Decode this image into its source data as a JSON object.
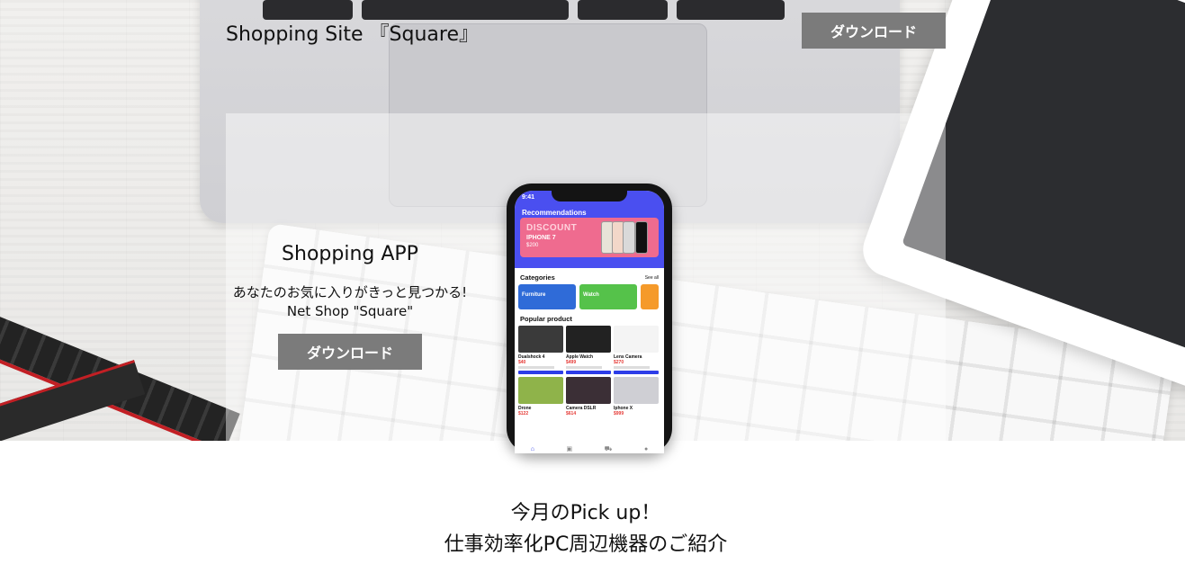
{
  "header": {
    "site_title": "Shopping Site 『Square』",
    "download_label": "ダウンロード"
  },
  "hero": {
    "title": "Shopping APP",
    "subtitle_line1": "あなたのお気に入りがきっと見つかる!",
    "subtitle_line2": "Net Shop \"Square\"",
    "download_label": "ダウンロード"
  },
  "phone_screen": {
    "time": "9:41",
    "recommendations": "Recommendations",
    "banner": {
      "discount": "DISCOUNT",
      "product": "IPHONE 7",
      "price": "$200"
    },
    "categories_title": "Categories",
    "see_all": "See all",
    "categories": [
      {
        "label": "Furniture",
        "color": "#2f6bd8"
      },
      {
        "label": "Watch",
        "color": "#55c24a"
      },
      {
        "label": "",
        "color": "#f59a2a"
      }
    ],
    "popular_title": "Popular product",
    "products": [
      {
        "name": "Dualshock 4",
        "price": "$40"
      },
      {
        "name": "Apple Watch",
        "price": "$499"
      },
      {
        "name": "Lens Camera",
        "price": "$270"
      },
      {
        "name": "Drone",
        "price": "$122"
      },
      {
        "name": "Camera DSLR",
        "price": "$614"
      },
      {
        "name": "Iphone X",
        "price": "$999"
      }
    ]
  },
  "pickup": {
    "line1": "今月のPick up！",
    "line2": "仕事効率化PC周辺機器のご紹介"
  },
  "colors": {
    "button_bg": "#7b7b7b",
    "button_text": "#ffffff",
    "app_primary": "#4a4ff0",
    "banner_pink": "#ef6b8f"
  }
}
